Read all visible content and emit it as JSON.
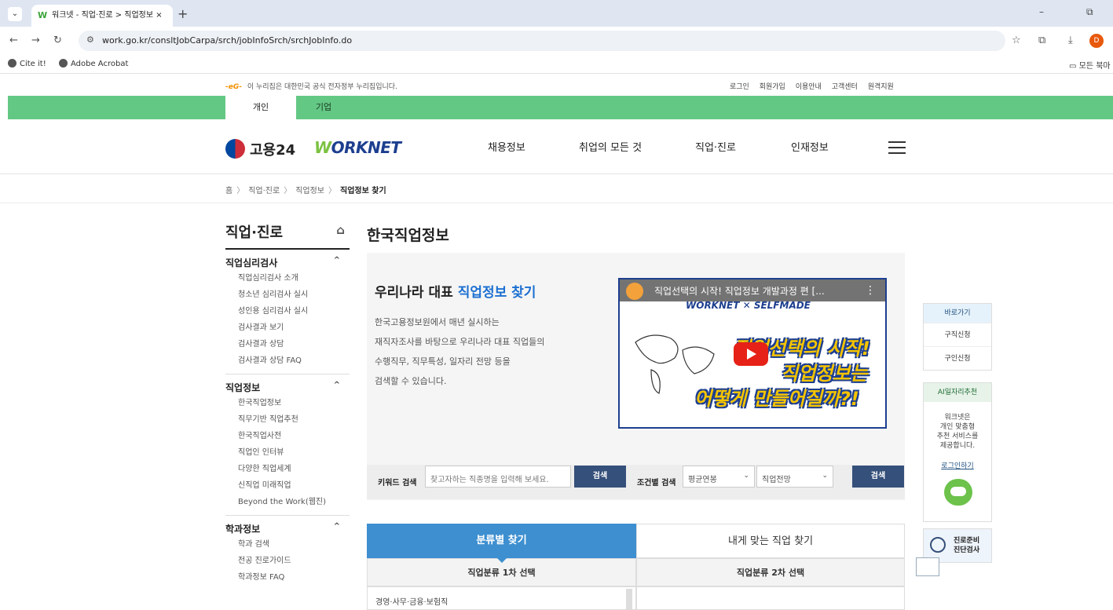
{
  "browser": {
    "tab_title": "워크넷 - 직업·진로 > 직업정보 ×",
    "tab_close": "×",
    "new_tab": "+",
    "url": "work.go.kr/consltJobCarpa/srch/jobInfoSrch/srchJobInfo.do",
    "bookmarks": [
      "Cite it!",
      "Adobe Acrobat"
    ],
    "bookmarks_right": "모든 북마",
    "profile_initial": "D"
  },
  "site": {
    "gov_logo": "-eG-",
    "gov_notice": "이 누리집은 대한민국 공식 전자정부 누리집입니다.",
    "util_links": [
      "로그인",
      "회원가입",
      "이용안내",
      "고객센터",
      "원격지원"
    ],
    "audience_tabs": [
      "개인",
      "기업"
    ],
    "logo_text": "고용24",
    "worknet_w": "W",
    "worknet_rest": "ORKNET",
    "main_nav": [
      "채용정보",
      "취업의 모든 것",
      "직업·진로",
      "인재정보"
    ],
    "breadcrumb": [
      "홈",
      "직업·진로",
      "직업정보",
      "직업정보 찾기"
    ],
    "breadcrumb_sep": "〉"
  },
  "sidebar": {
    "title": "직업·진로",
    "groups": [
      {
        "label": "직업심리검사",
        "items": [
          "직업심리검사 소개",
          "청소년 심리검사 실시",
          "성인용 심리검사 실시",
          "검사결과 보기",
          "검사결과 상담",
          "검사결과 상담 FAQ"
        ]
      },
      {
        "label": "직업정보",
        "items": [
          "한국직업정보",
          "직무기반 직업추천",
          "한국직업사전",
          "직업인 인터뷰",
          "다양한 직업세계",
          "신직업 미래직업",
          "Beyond the Work(웹진)"
        ]
      },
      {
        "label": "학과정보",
        "items": [
          "학과 검색",
          "전공 진로가이드",
          "학과정보 FAQ"
        ]
      }
    ],
    "toggle": "^",
    "home_icon": "⌂"
  },
  "main": {
    "title": "한국직업정보",
    "hero_heading_a": "우리나라 대표 ",
    "hero_heading_b": "직업정보 찾기",
    "hero_lines": [
      "한국고용정보원에서 매년 실시하는",
      "재직자조사를 바탕으로 우리나라 대표 직업들의",
      "수행직무, 직무특성, 일자리 전망 등을",
      "검색할 수 있습니다."
    ],
    "video_title": "직업선택의 시작! 직업정보 개발과정 편 [...",
    "video_brand": "WORKNET ✕ SELFMADE",
    "video_big1": "직업선택의 시작!",
    "video_big2": "직업정보는",
    "video_big3": "어떻게 만들어질까?!",
    "video_dots": "⋮"
  },
  "search": {
    "keyword_label": "키워드 검색",
    "keyword_placeholder": "찾고자하는 직종명을 입력해 보세요.",
    "search_btn": "검색",
    "cond_label": "조건별 검색",
    "salary_select": "평균연봉",
    "outlook_select": "직업전망",
    "caret": "⌄"
  },
  "category": {
    "tab_a": "분류별 찾기",
    "tab_b": "내게 맞는 직업 찾기",
    "sub_a": "직업분류 1차 선택",
    "sub_b": "직업분류 2차 선택",
    "first_item": "경영·사무·금융·보험직"
  },
  "quick": {
    "header": "바로가기",
    "items": [
      "구직신청",
      "구인신청"
    ]
  },
  "ai": {
    "header": "AI일자리추천",
    "lines": [
      "워크넷은",
      "개인 맞춤형",
      "추천 서비스를",
      "제공합니다."
    ],
    "login": "로그인하기"
  },
  "diag": {
    "line1": "진로준비",
    "line2": "진단검사"
  },
  "colors": {
    "green_bar": "#63c884",
    "tab_active": "#3d8fd0",
    "search_btn": "#35507a",
    "accent_link": "#1c6fd1"
  }
}
